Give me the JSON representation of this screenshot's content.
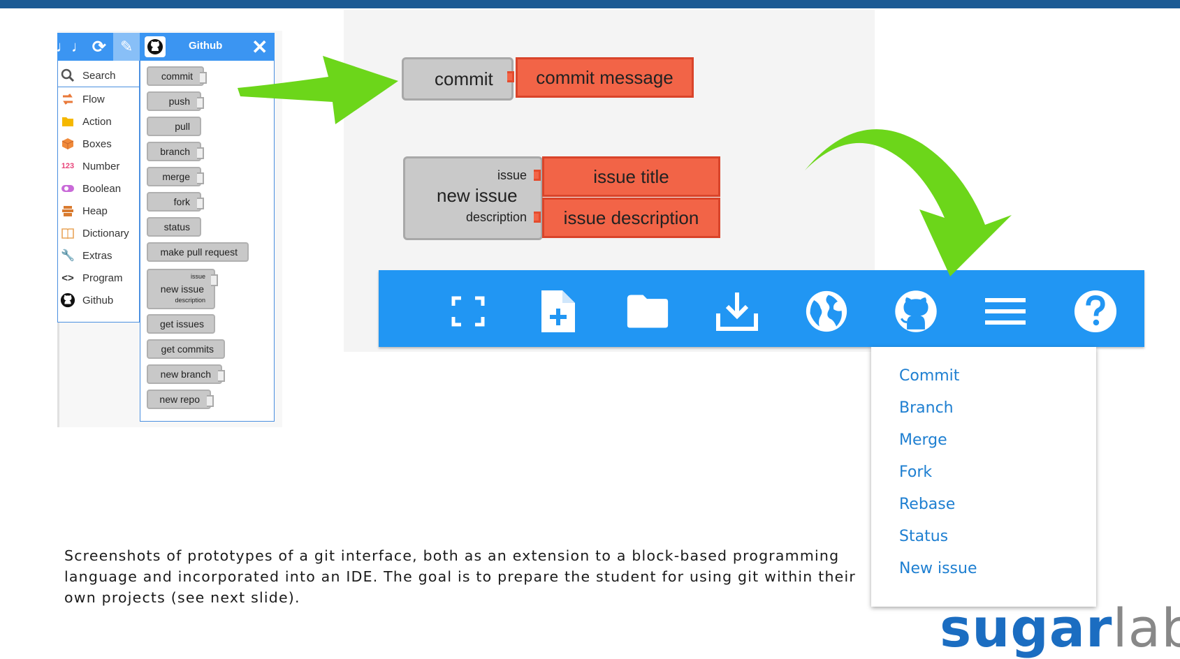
{
  "palette": {
    "header_title": "Github",
    "categories": [
      {
        "label": "Search",
        "icon": "search-icon",
        "color": "#555555"
      },
      {
        "label": "Flow",
        "icon": "flow-icon",
        "color": "#e9793a"
      },
      {
        "label": "Action",
        "icon": "action-icon",
        "color": "#f5b800"
      },
      {
        "label": "Boxes",
        "icon": "boxes-icon",
        "color": "#f08a3a"
      },
      {
        "label": "Number",
        "icon": "number-icon",
        "color": "#e8457a"
      },
      {
        "label": "Boolean",
        "icon": "boolean-icon",
        "color": "#c96ad8"
      },
      {
        "label": "Heap",
        "icon": "heap-icon",
        "color": "#d97b2f"
      },
      {
        "label": "Dictionary",
        "icon": "dictionary-icon",
        "color": "#e9a55a"
      },
      {
        "label": "Extras",
        "icon": "extras-icon",
        "color": "#777777"
      },
      {
        "label": "Program",
        "icon": "program-icon",
        "color": "#333333"
      },
      {
        "label": "Github",
        "icon": "github-icon",
        "color": "#111111"
      }
    ],
    "number_icon_text": "123",
    "program_icon_text": "<>",
    "blocks": [
      "commit",
      "push",
      "pull",
      "branch",
      "merge",
      "fork",
      "status",
      "make pull request",
      "new issue",
      "get issues",
      "get commits",
      "new branch",
      "new repo"
    ],
    "new_issue_args": [
      "issue",
      "description"
    ]
  },
  "block_demo": {
    "commit_label": "commit",
    "commit_arg": "commit message",
    "new_issue_label": "new issue",
    "issue_arg_label": "issue",
    "description_arg_label": "description",
    "issue_title": "issue title",
    "issue_description": "issue description"
  },
  "toolbar": {
    "color": "#2196f3",
    "icons": [
      "fullscreen-icon",
      "new-file-icon",
      "folder-icon",
      "download-icon",
      "globe-icon",
      "github-icon",
      "menu-icon",
      "help-icon"
    ]
  },
  "git_menu": {
    "items": [
      "Commit",
      "Branch",
      "Merge",
      "Fork",
      "Rebase",
      "Status",
      "New issue"
    ]
  },
  "caption": "Screenshots of prototypes of a git interface, both as an extension to a block-based programming language and incorporated into an IDE. The goal is to prepare the student for using git within their own projects (see next slide).",
  "logo": {
    "sugar": "sugar",
    "labs": "labs"
  },
  "colors": {
    "arrow": "#6cd61a",
    "block_arg": "#f26447",
    "block": "#c9c9c9",
    "menu_text": "#1e7fd1",
    "brand_blue": "#1b6dc1"
  }
}
